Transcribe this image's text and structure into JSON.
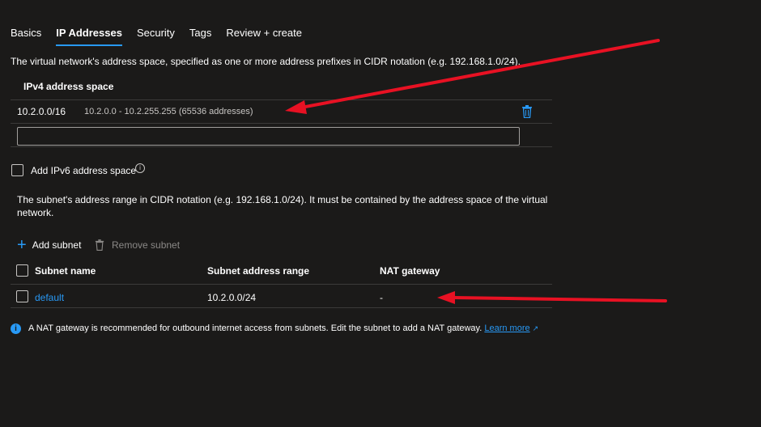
{
  "tabs": [
    {
      "label": "Basics"
    },
    {
      "label": "IP Addresses"
    },
    {
      "label": "Security"
    },
    {
      "label": "Tags"
    },
    {
      "label": "Review + create"
    }
  ],
  "address_space": {
    "description": "The virtual network's address space, specified as one or more address prefixes in CIDR notation (e.g. 192.168.1.0/24).",
    "header": "IPv4 address space",
    "rows": [
      {
        "prefix": "10.2.0.0/16",
        "range": "10.2.0.0 - 10.2.255.255 (65536 addresses)"
      }
    ],
    "new_input_value": ""
  },
  "ipv6": {
    "label": "Add IPv6 address space",
    "info": "i"
  },
  "subnets": {
    "description": "The subnet's address range in CIDR notation (e.g. 192.168.1.0/24). It must be contained by the address space of the virtual network.",
    "add_label": "Add subnet",
    "remove_label": "Remove subnet",
    "columns": [
      "Subnet name",
      "Subnet address range",
      "NAT gateway"
    ],
    "rows": [
      {
        "name": "default",
        "range": "10.2.0.0/24",
        "nat": "-"
      }
    ]
  },
  "nat_note": {
    "text": "A NAT gateway is recommended for outbound internet access from subnets. Edit the subnet to add a NAT gateway.",
    "link": "Learn more"
  },
  "colors": {
    "accent": "#2899f5",
    "annotation": "#e81123",
    "background": "#1b1a19"
  }
}
